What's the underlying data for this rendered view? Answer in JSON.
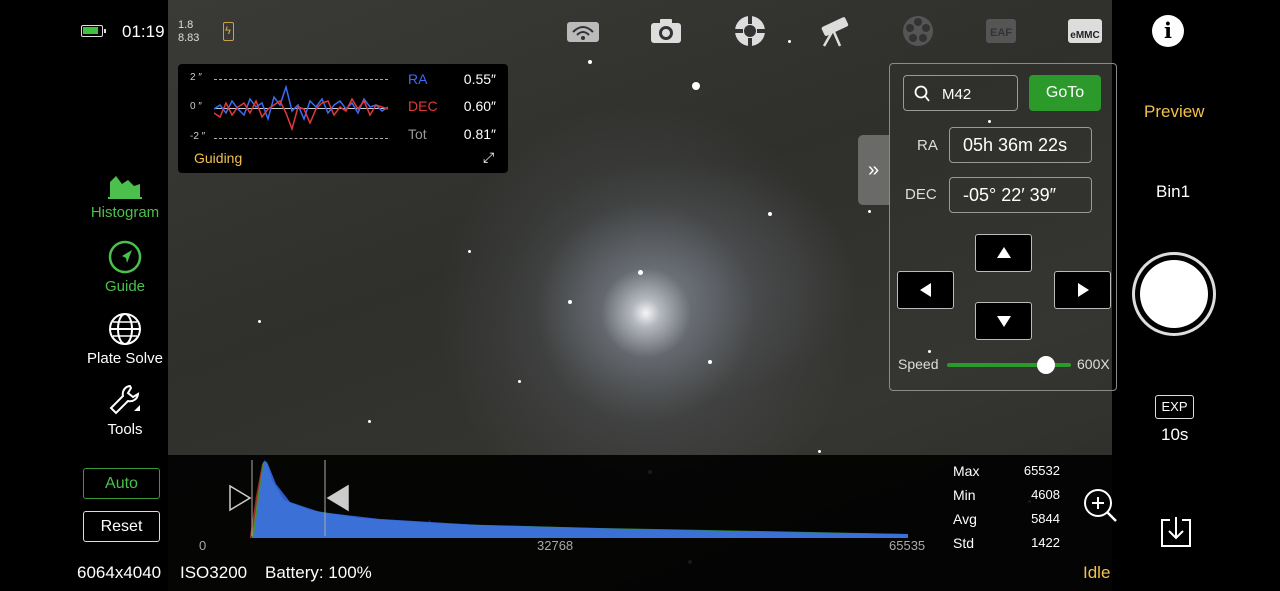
{
  "status": {
    "time": "01:19",
    "num_top": "1.8",
    "num_bottom": "8.83"
  },
  "topbar": {
    "icons": [
      "wifi-icon",
      "camera-icon",
      "mount-icon",
      "telescope-icon",
      "filter-wheel-icon",
      "eaf-icon",
      "emmc-icon",
      "info-icon"
    ],
    "eaf_label": "EAF",
    "emmc_label": "eMMC",
    "info_label": "i"
  },
  "tools": [
    {
      "label": "Histogram",
      "icon": "histogram-icon",
      "active": true
    },
    {
      "label": "Guide",
      "icon": "guide-icon",
      "active": true
    },
    {
      "label": "Plate Solve",
      "icon": "globe-icon",
      "active": false
    },
    {
      "label": "Tools",
      "icon": "wrench-icon",
      "active": false
    }
  ],
  "guiding": {
    "y_ticks": [
      "2 ″",
      "0 ″",
      "-2 ″"
    ],
    "ra_label": "RA",
    "ra_value": "0.55″",
    "dec_label": "DEC",
    "dec_value": "0.60″",
    "tot_label": "Tot",
    "tot_value": "0.81″",
    "title": "Guiding",
    "colors": {
      "ra": "#3a6cf5",
      "dec": "#e23a3a"
    }
  },
  "goto": {
    "search_value": "M42",
    "goto_label": "GoTo",
    "ra_label": "RA",
    "ra_value": "05h 36m 22s",
    "dec_label": "DEC",
    "dec_value": "-05° 22′ 39″",
    "speed_label": "Speed",
    "speed_value": "600X",
    "speed_fraction": 0.8
  },
  "right": {
    "preview": "Preview",
    "bin": "Bin1",
    "exp_label": "EXP",
    "exp_value": "10s"
  },
  "histogram": {
    "auto_label": "Auto",
    "reset_label": "Reset",
    "ticks": [
      "0",
      "32768",
      "65535"
    ],
    "stats": [
      {
        "label": "Max",
        "value": "65532"
      },
      {
        "label": "Min",
        "value": "4608"
      },
      {
        "label": "Avg",
        "value": "5844"
      },
      {
        "label": "Std",
        "value": "1422"
      }
    ]
  },
  "footer": {
    "resolution": "6064x4040",
    "iso": "ISO3200",
    "battery": "Battery: 100%",
    "state": "Idle"
  },
  "colors": {
    "accent_green": "#2b9a2b",
    "accent_yellow": "#f2c14e"
  }
}
